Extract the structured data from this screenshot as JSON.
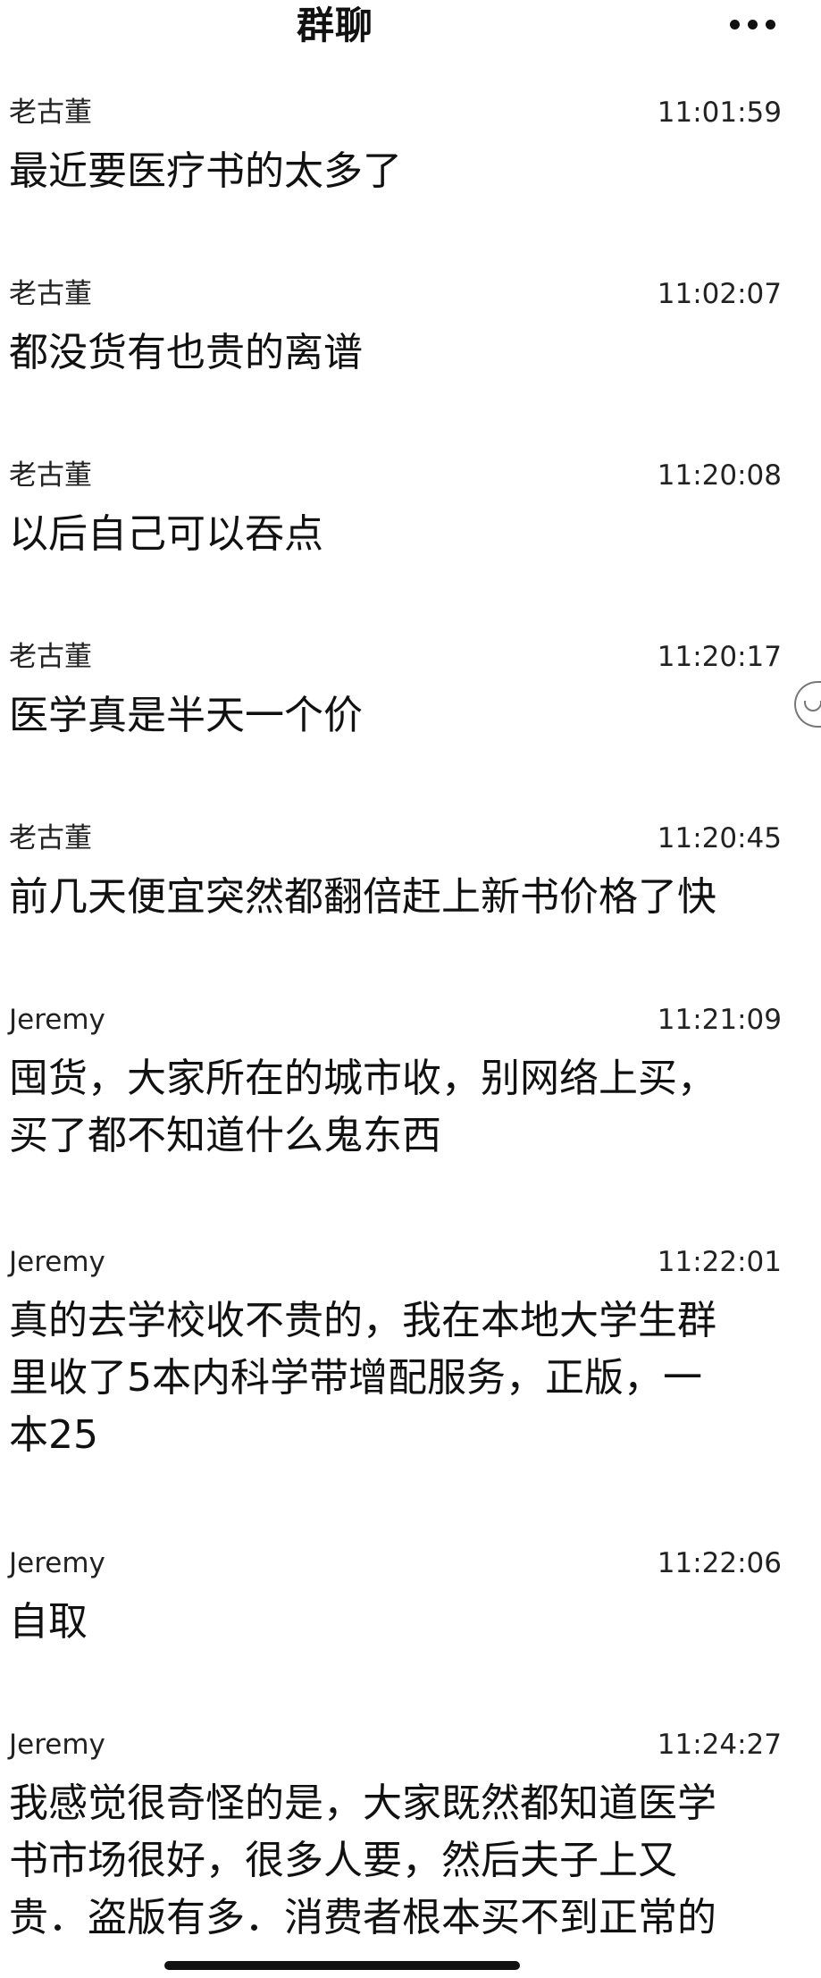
{
  "header": {
    "title": "群聊",
    "more_icon": "more-dots-icon"
  },
  "messages": [
    {
      "sender": "老古董",
      "time": "11:01:59",
      "text": "最近要医疗书的太多了"
    },
    {
      "sender": "老古董",
      "time": "11:02:07",
      "text": "都没货有也贵的离谱"
    },
    {
      "sender": "老古董",
      "time": "11:20:08",
      "text": "以后自己可以吞点"
    },
    {
      "sender": "老古董",
      "time": "11:20:17",
      "text": "医学真是半天一个价"
    },
    {
      "sender": "老古董",
      "time": "11:20:45",
      "text": "前几天便宜突然都翻倍赶上新书价格了快"
    },
    {
      "sender": "Jeremy",
      "time": "11:21:09",
      "text": "囤货，大家所在的城市收，别网络上买，\n买了都不知道什么鬼东西"
    },
    {
      "sender": "Jeremy",
      "time": "11:22:01",
      "text": "真的去学校收不贵的，我在本地大学生群\n里收了5本内科学带增配服务，正版，一\n本25"
    },
    {
      "sender": "Jeremy",
      "time": "11:22:06",
      "text": "自取"
    },
    {
      "sender": "Jeremy",
      "time": "11:24:27",
      "text": "我感觉很奇怪的是，大家既然都知道医学\n书市场很好，很多人要，然后夫子上又\n贵．盗版有多．消费者根本买不到正常的"
    }
  ]
}
